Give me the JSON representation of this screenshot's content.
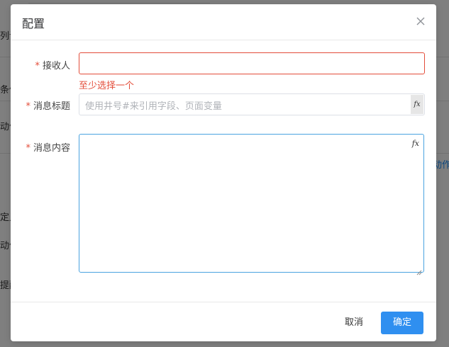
{
  "background": {
    "fragments": [
      "列设",
      "条件",
      "动作",
      "动作",
      "定义",
      "动作",
      "提醒"
    ]
  },
  "dialog": {
    "title": "配置",
    "close_icon": "close-icon"
  },
  "form": {
    "required_mark": "*",
    "receiver": {
      "label": "接收人",
      "value": "",
      "error": "至少选择一个"
    },
    "message_title": {
      "label": "消息标题",
      "placeholder": "使用井号#来引用字段、页面变量",
      "fx_label": "fx"
    },
    "message_content": {
      "label": "消息内容",
      "value": "",
      "fx_label": "fx"
    }
  },
  "footer": {
    "cancel_label": "取消",
    "confirm_label": "确定"
  },
  "colors": {
    "error": "#e34d3a",
    "primary": "#2f8ff0",
    "focus_border": "#4aa3e0"
  }
}
